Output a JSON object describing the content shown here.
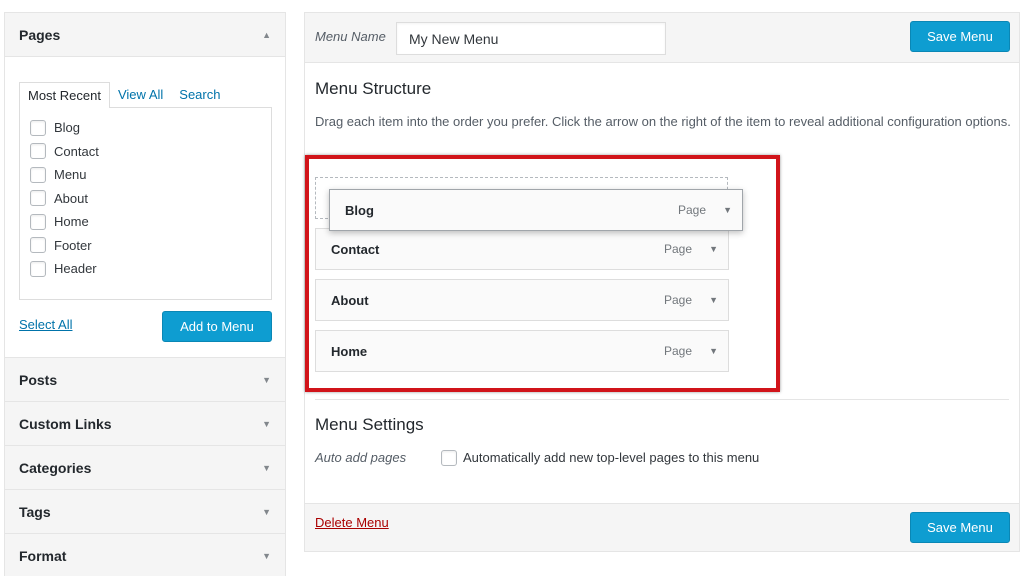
{
  "sidebar": {
    "pages_title": "Pages",
    "tabs": [
      "Most Recent",
      "View All",
      "Search"
    ],
    "page_items": [
      "Blog",
      "Contact",
      "Menu",
      "About",
      "Home",
      "Footer",
      "Header"
    ],
    "select_all": "Select All",
    "add_to_menu": "Add to Menu",
    "sections": [
      "Posts",
      "Custom Links",
      "Categories",
      "Tags",
      "Format"
    ]
  },
  "editor": {
    "menu_name_label": "Menu Name",
    "menu_name_value": "My New Menu",
    "save_label": "Save Menu",
    "structure_title": "Menu Structure",
    "structure_desc": "Drag each item into the order you prefer. Click the arrow on the right of the item to reveal additional configuration options.",
    "items": [
      {
        "title": "Blog",
        "type": "Page"
      },
      {
        "title": "Contact",
        "type": "Page"
      },
      {
        "title": "About",
        "type": "Page"
      },
      {
        "title": "Home",
        "type": "Page"
      }
    ],
    "settings_title": "Menu Settings",
    "auto_add_label": "Auto add pages",
    "auto_add_text": "Automatically add new top-level pages to this menu",
    "delete_label": "Delete Menu"
  },
  "colors": {
    "primary_button": "#0e9dd1",
    "highlight_box": "#d1141a",
    "link": "#0073aa",
    "delete_link": "#aa0000"
  },
  "icons": {
    "accordion_open": "triangle-up-icon",
    "accordion_closed": "triangle-down-icon",
    "item_toggle": "triangle-down-icon"
  }
}
